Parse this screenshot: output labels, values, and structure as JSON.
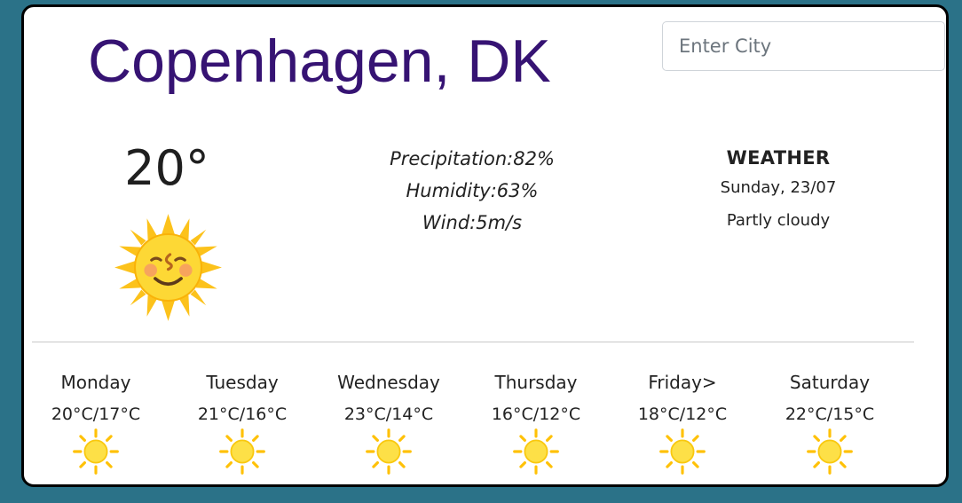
{
  "location": {
    "city": "Copenhagen, DK"
  },
  "search": {
    "placeholder": "Enter City"
  },
  "current": {
    "temperature": "20°",
    "icon": "sun-with-face-icon",
    "precipitation": "Precipitation:82%",
    "humidity": "Humidity:63%",
    "wind": "Wind:5m/s"
  },
  "summary": {
    "heading": "WEATHER",
    "date": "Sunday, 23/07",
    "condition": "Partly cloudy"
  },
  "forecast": [
    {
      "day": "Monday",
      "range": "20°C/17°C",
      "icon": "sun-icon"
    },
    {
      "day": "Tuesday",
      "range": "21°C/16°C",
      "icon": "sun-icon"
    },
    {
      "day": "Wednesday",
      "range": "23°C/14°C",
      "icon": "sun-icon"
    },
    {
      "day": "Thursday",
      "range": "16°C/12°C",
      "icon": "sun-icon"
    },
    {
      "day": "Friday>",
      "range": "18°C/12°C",
      "icon": "sun-icon"
    },
    {
      "day": "Saturday",
      "range": "22°C/15°C",
      "icon": "sun-icon"
    }
  ],
  "colors": {
    "background": "#2b7288",
    "city": "#361373",
    "sun": "#ffc107"
  }
}
